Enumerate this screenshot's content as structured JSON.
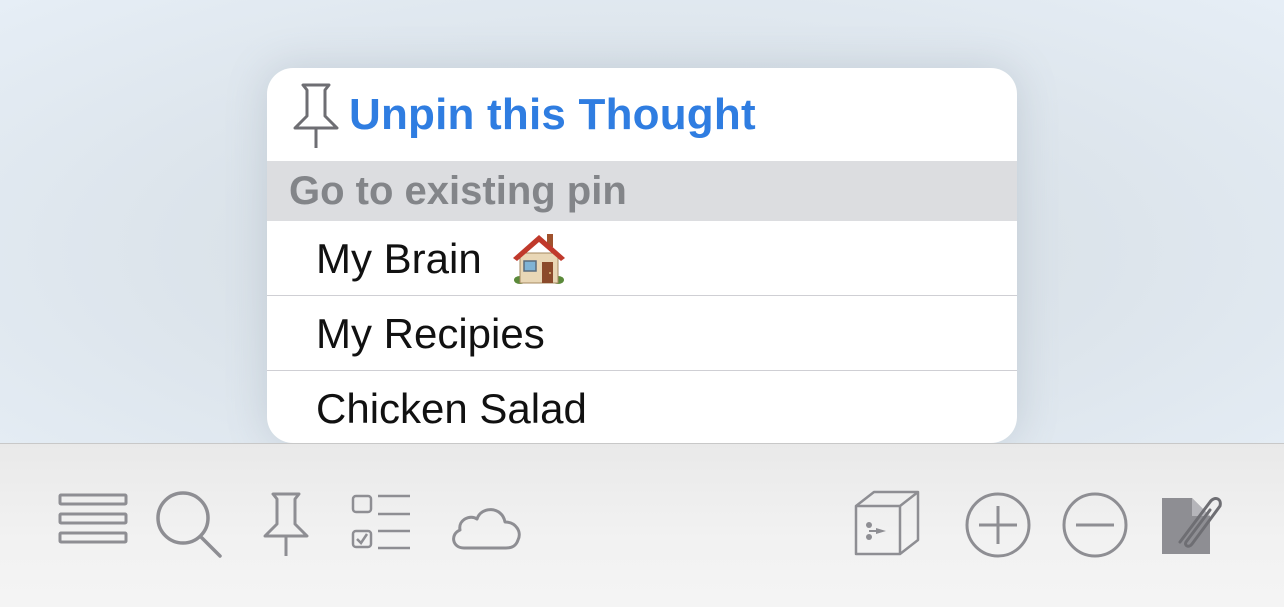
{
  "popover": {
    "unpin_label": "Unpin this Thought",
    "section_header": "Go to existing pin",
    "pins": [
      {
        "label": "My Brain",
        "emoji_icon": "house-icon"
      },
      {
        "label": "My Recipies"
      },
      {
        "label": "Chicken Salad"
      }
    ]
  },
  "toolbar": {
    "left_icons": [
      "list-menu-icon",
      "search-icon",
      "pin-icon",
      "checklist-icon",
      "cloud-icon"
    ],
    "right_icons": [
      "box-link-icon",
      "add-icon",
      "remove-icon",
      "attachment-icon"
    ]
  },
  "colors": {
    "accent": "#2f7de1",
    "icon_gray": "#8e8e93",
    "section_header_bg": "#dcdde0",
    "section_header_text": "#838589"
  }
}
